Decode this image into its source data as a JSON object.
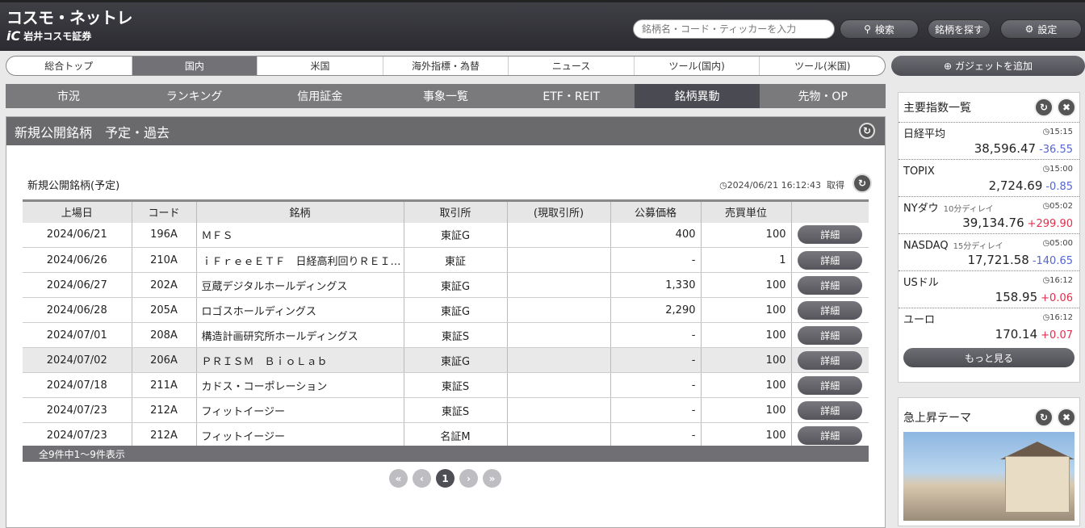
{
  "header": {
    "logo_main": "コスモ・ネットレ",
    "logo_mark": "iC",
    "logo_sub": "岩井コスモ証券",
    "search_placeholder": "銘柄名・コード・ティッカーを入力",
    "search_button": "検索",
    "find_button": "銘柄を探す",
    "settings_button": "設定"
  },
  "global_nav": {
    "items": [
      "総合トップ",
      "国内",
      "米国",
      "海外指標・為替",
      "ニュース",
      "ツール(国内)",
      "ツール(米国)"
    ],
    "active": "国内",
    "add_gadget": "ガジェットを追加"
  },
  "sub_nav": {
    "items": [
      "市況",
      "ランキング",
      "信用証金",
      "事象一覧",
      "ETF・REIT",
      "銘柄異動",
      "先物・OP"
    ],
    "active": "銘柄異動"
  },
  "panel": {
    "title": "新規公開銘柄　予定・過去",
    "section_title": "新規公開銘柄(予定)",
    "timestamp": "2024/06/21 16:12:43",
    "fetch_label": "取得",
    "columns": [
      "上場日",
      "コード",
      "銘柄",
      "取引所",
      "(現取引所)",
      "公募価格",
      "売買単位",
      ""
    ],
    "rows": [
      {
        "date": "2024/06/21",
        "code": "196A",
        "name": "ＭＦＳ",
        "exchange": "東証G",
        "current_exchange": "",
        "price": "400",
        "unit": "100",
        "detail": "詳細"
      },
      {
        "date": "2024/06/26",
        "code": "210A",
        "name": "ｉＦｒｅｅＥＴＦ　日経高利回りＲＥＩ…",
        "exchange": "東証",
        "current_exchange": "",
        "price": "-",
        "unit": "1",
        "detail": "詳細"
      },
      {
        "date": "2024/06/27",
        "code": "202A",
        "name": "豆蔵デジタルホールディングス",
        "exchange": "東証G",
        "current_exchange": "",
        "price": "1,330",
        "unit": "100",
        "detail": "詳細"
      },
      {
        "date": "2024/06/28",
        "code": "205A",
        "name": "ロゴスホールディングス",
        "exchange": "東証G",
        "current_exchange": "",
        "price": "2,290",
        "unit": "100",
        "detail": "詳細"
      },
      {
        "date": "2024/07/01",
        "code": "208A",
        "name": "構造計画研究所ホールディングス",
        "exchange": "東証S",
        "current_exchange": "",
        "price": "-",
        "unit": "100",
        "detail": "詳細"
      },
      {
        "date": "2024/07/02",
        "code": "206A",
        "name": "ＰＲＩＳＭ　ＢｉｏＬａｂ",
        "exchange": "東証G",
        "current_exchange": "",
        "price": "-",
        "unit": "100",
        "detail": "詳細"
      },
      {
        "date": "2024/07/18",
        "code": "211A",
        "name": "カドス・コーポレーション",
        "exchange": "東証S",
        "current_exchange": "",
        "price": "-",
        "unit": "100",
        "detail": "詳細"
      },
      {
        "date": "2024/07/23",
        "code": "212A",
        "name": "フィットイージー",
        "exchange": "東証S",
        "current_exchange": "",
        "price": "-",
        "unit": "100",
        "detail": "詳細"
      },
      {
        "date": "2024/07/23",
        "code": "212A",
        "name": "フィットイージー",
        "exchange": "名証M",
        "current_exchange": "",
        "price": "-",
        "unit": "100",
        "detail": "詳細"
      }
    ],
    "footer": "全9件中1～9件表示",
    "pager": {
      "first": "«",
      "prev": "‹",
      "current": "1",
      "next": "›",
      "last": "»"
    }
  },
  "indices": {
    "title": "主要指数一覧",
    "items": [
      {
        "name": "日経平均",
        "delay": "",
        "time": "15:15",
        "value": "38,596.47",
        "change": "-36.55",
        "dir": "dn"
      },
      {
        "name": "TOPIX",
        "delay": "",
        "time": "15:00",
        "value": "2,724.69",
        "change": "-0.85",
        "dir": "dn"
      },
      {
        "name": "NYダウ",
        "delay": "10分ディレイ",
        "time": "05:02",
        "value": "39,134.76",
        "change": "+299.90",
        "dir": "up"
      },
      {
        "name": "NASDAQ",
        "delay": "15分ディレイ",
        "time": "05:00",
        "value": "17,721.58",
        "change": "-140.65",
        "dir": "dn"
      },
      {
        "name": "USドル",
        "delay": "",
        "time": "16:12",
        "value": "158.95",
        "change": "+0.06",
        "dir": "up"
      },
      {
        "name": "ユーロ",
        "delay": "",
        "time": "16:12",
        "value": "170.14",
        "change": "+0.07",
        "dir": "up"
      }
    ],
    "more_button": "もっと見る"
  },
  "theme": {
    "title": "急上昇テーマ"
  },
  "icons": {
    "search": "search-icon",
    "settings": "gear-icon",
    "add": "plus-circle-icon",
    "refresh": "refresh-icon",
    "close": "close-icon",
    "clock": "clock-icon"
  }
}
